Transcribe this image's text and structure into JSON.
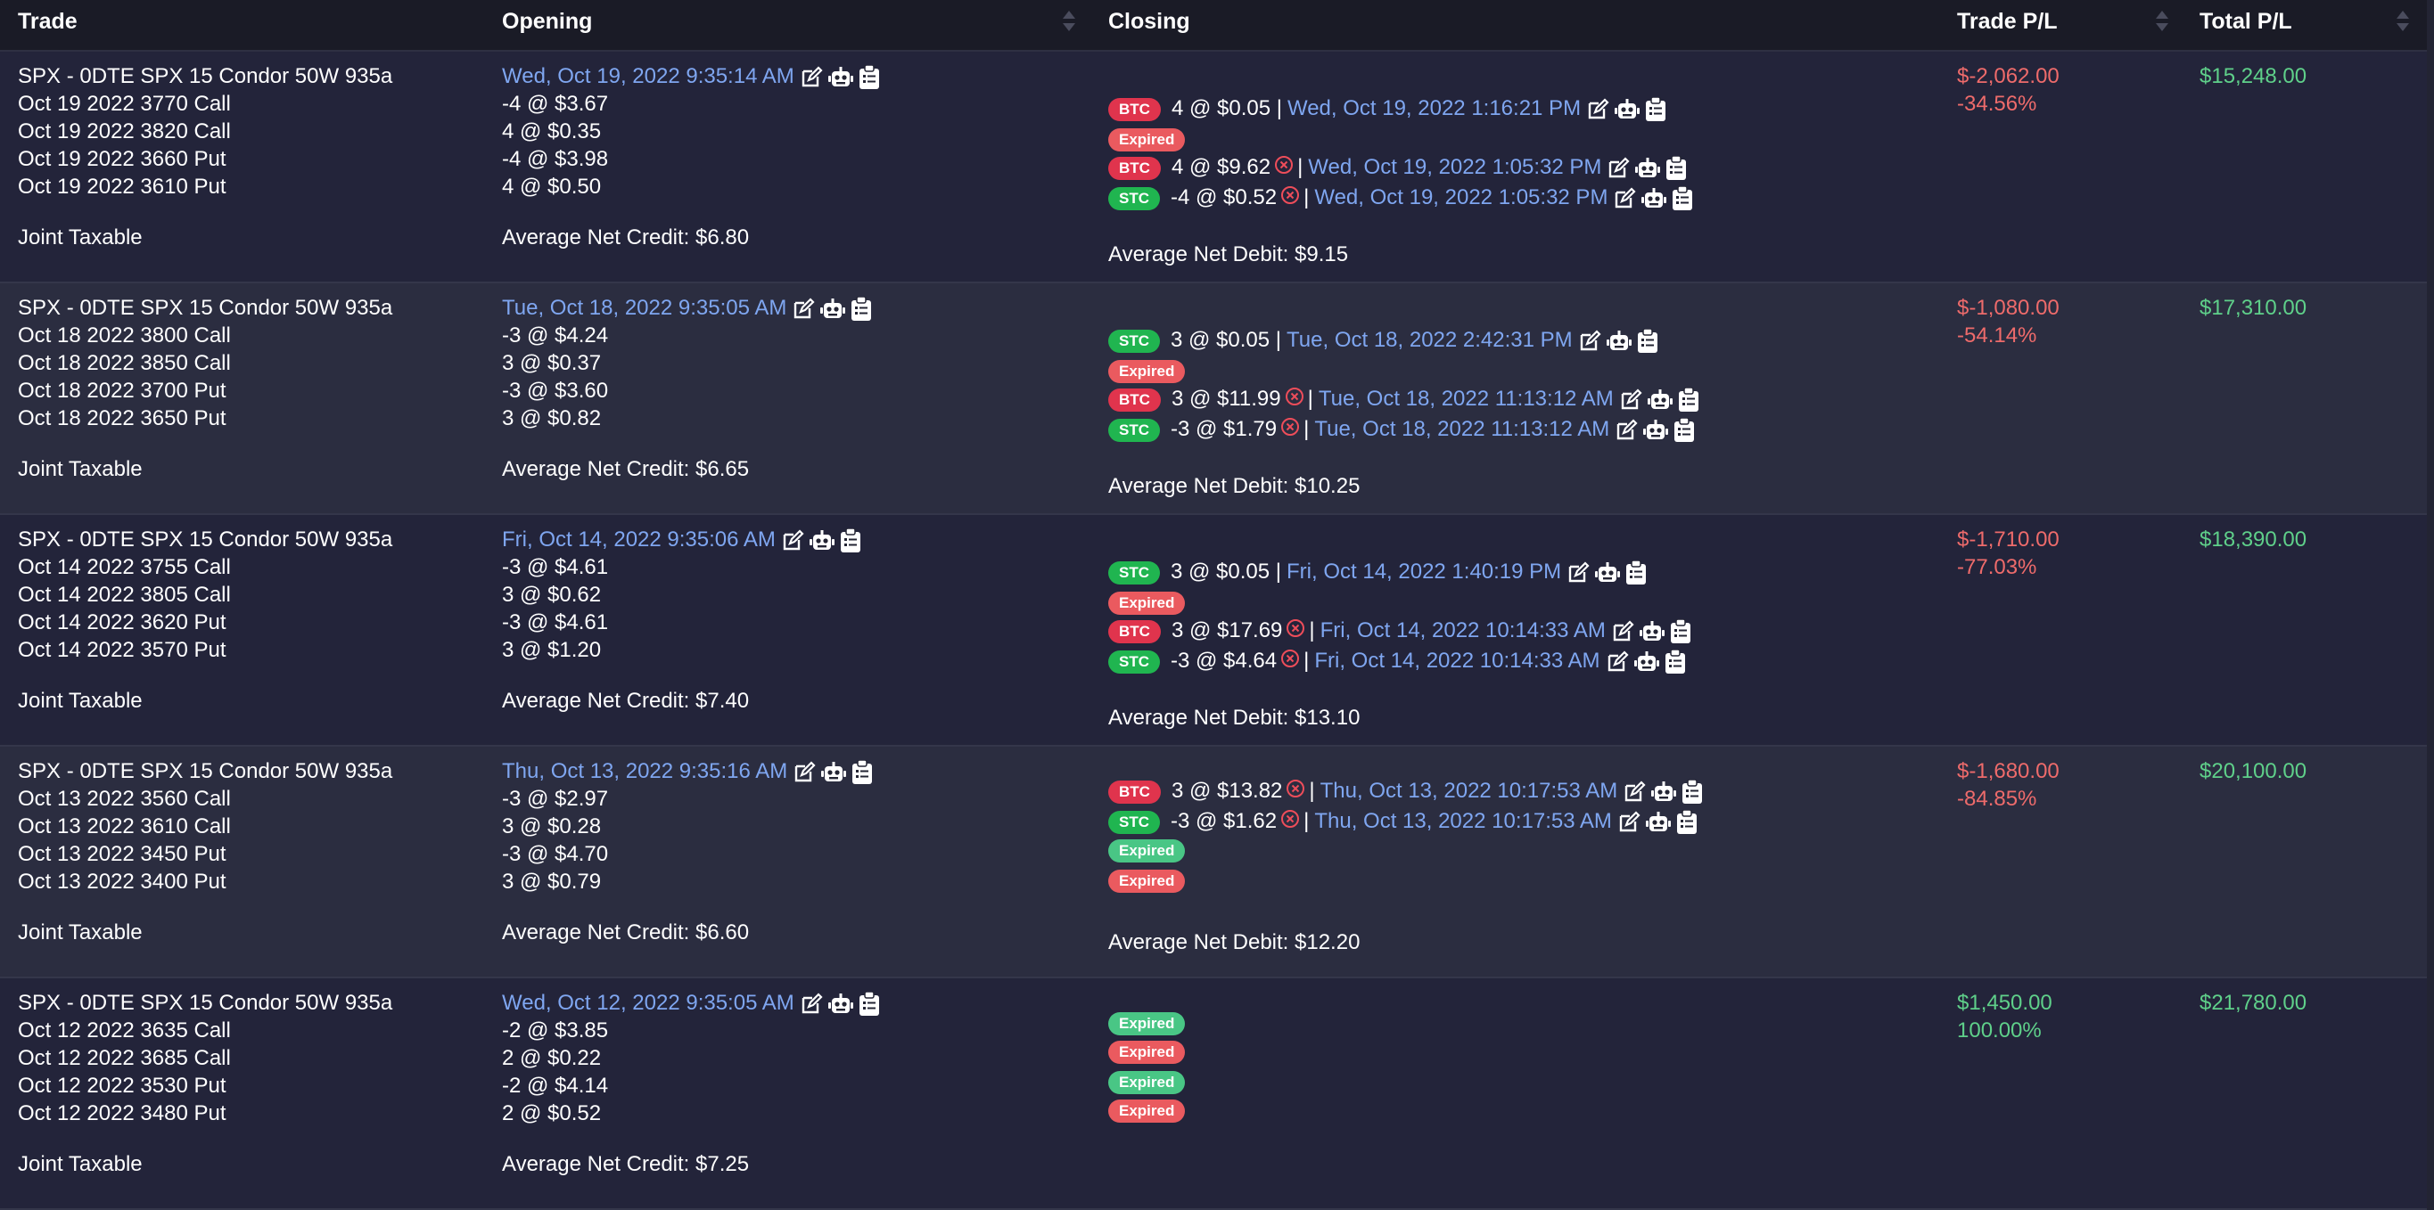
{
  "headers": {
    "trade": "Trade",
    "opening": "Opening",
    "closing": "Closing",
    "trade_pl": "Trade P/L",
    "total_pl": "Total P/L"
  },
  "trades": [
    {
      "title": "SPX - 0DTE SPX 15 Condor 50W 935a",
      "legs": [
        "Oct 19 2022 3770 Call",
        "Oct 19 2022 3820 Call",
        "Oct 19 2022 3660 Put",
        "Oct 19 2022 3610 Put"
      ],
      "account": "Joint Taxable",
      "open_date": "Wed, Oct 19, 2022 9:35:14 AM",
      "open_fills": [
        "-4 @ $3.67",
        "4 @ $0.35",
        "-4 @ $3.98",
        "4 @ $0.50"
      ],
      "avg_open": "Average Net Credit: $6.80",
      "closings": [
        {
          "badge": "BTC",
          "color": "btc",
          "fill": "4 @ $0.05",
          "x": false,
          "date": "Wed, Oct 19, 2022 1:16:21 PM"
        },
        {
          "badge": "Expired",
          "color": "exp-red"
        },
        {
          "badge": "BTC",
          "color": "btc",
          "fill": "4 @ $9.62",
          "x": true,
          "date": "Wed, Oct 19, 2022 1:05:32 PM"
        },
        {
          "badge": "STC",
          "color": "stc",
          "fill": "-4 @ $0.52",
          "x": true,
          "date": "Wed, Oct 19, 2022 1:05:32 PM"
        }
      ],
      "avg_close": "Average Net Debit: $9.15",
      "trade_pl": "$-2,062.00",
      "trade_pct": "-34.56%",
      "trade_pl_sign": "neg",
      "total_pl": "$15,248.00"
    },
    {
      "title": "SPX - 0DTE SPX 15 Condor 50W 935a",
      "legs": [
        "Oct 18 2022 3800 Call",
        "Oct 18 2022 3850 Call",
        "Oct 18 2022 3700 Put",
        "Oct 18 2022 3650 Put"
      ],
      "account": "Joint Taxable",
      "open_date": "Tue, Oct 18, 2022 9:35:05 AM",
      "open_fills": [
        "-3 @ $4.24",
        "3 @ $0.37",
        "-3 @ $3.60",
        "3 @ $0.82"
      ],
      "avg_open": "Average Net Credit: $6.65",
      "closings": [
        {
          "badge": "STC",
          "color": "stc",
          "fill": "3 @ $0.05",
          "x": false,
          "date": "Tue, Oct 18, 2022 2:42:31 PM"
        },
        {
          "badge": "Expired",
          "color": "exp-red"
        },
        {
          "badge": "BTC",
          "color": "btc",
          "fill": "3 @ $11.99",
          "x": true,
          "date": "Tue, Oct 18, 2022 11:13:12 AM"
        },
        {
          "badge": "STC",
          "color": "stc",
          "fill": "-3 @ $1.79",
          "x": true,
          "date": "Tue, Oct 18, 2022 11:13:12 AM"
        }
      ],
      "avg_close": "Average Net Debit: $10.25",
      "trade_pl": "$-1,080.00",
      "trade_pct": "-54.14%",
      "trade_pl_sign": "neg",
      "total_pl": "$17,310.00"
    },
    {
      "title": "SPX - 0DTE SPX 15 Condor 50W 935a",
      "legs": [
        "Oct 14 2022 3755 Call",
        "Oct 14 2022 3805 Call",
        "Oct 14 2022 3620 Put",
        "Oct 14 2022 3570 Put"
      ],
      "account": "Joint Taxable",
      "open_date": "Fri, Oct 14, 2022 9:35:06 AM",
      "open_fills": [
        "-3 @ $4.61",
        "3 @ $0.62",
        "-3 @ $4.61",
        "3 @ $1.20"
      ],
      "avg_open": "Average Net Credit: $7.40",
      "closings": [
        {
          "badge": "STC",
          "color": "stc",
          "fill": "3 @ $0.05",
          "x": false,
          "date": "Fri, Oct 14, 2022 1:40:19 PM"
        },
        {
          "badge": "Expired",
          "color": "exp-red"
        },
        {
          "badge": "BTC",
          "color": "btc",
          "fill": "3 @ $17.69",
          "x": true,
          "date": "Fri, Oct 14, 2022 10:14:33 AM"
        },
        {
          "badge": "STC",
          "color": "stc",
          "fill": "-3 @ $4.64",
          "x": true,
          "date": "Fri, Oct 14, 2022 10:14:33 AM"
        }
      ],
      "avg_close": "Average Net Debit: $13.10",
      "trade_pl": "$-1,710.00",
      "trade_pct": "-77.03%",
      "trade_pl_sign": "neg",
      "total_pl": "$18,390.00"
    },
    {
      "title": "SPX - 0DTE SPX 15 Condor 50W 935a",
      "legs": [
        "Oct 13 2022 3560 Call",
        "Oct 13 2022 3610 Call",
        "Oct 13 2022 3450 Put",
        "Oct 13 2022 3400 Put"
      ],
      "account": "Joint Taxable",
      "open_date": "Thu, Oct 13, 2022 9:35:16 AM",
      "open_fills": [
        "-3 @ $2.97",
        "3 @ $0.28",
        "-3 @ $4.70",
        "3 @ $0.79"
      ],
      "avg_open": "Average Net Credit: $6.60",
      "closings": [
        {
          "badge": "BTC",
          "color": "btc",
          "fill": "3 @ $13.82",
          "x": true,
          "date": "Thu, Oct 13, 2022 10:17:53 AM"
        },
        {
          "badge": "STC",
          "color": "stc",
          "fill": "-3 @ $1.62",
          "x": true,
          "date": "Thu, Oct 13, 2022 10:17:53 AM"
        },
        {
          "badge": "Expired",
          "color": "exp-green"
        },
        {
          "badge": "Expired",
          "color": "exp-red"
        }
      ],
      "avg_close": "Average Net Debit: $12.20",
      "trade_pl": "$-1,680.00",
      "trade_pct": "-84.85%",
      "trade_pl_sign": "neg",
      "total_pl": "$20,100.00"
    },
    {
      "title": "SPX - 0DTE SPX 15 Condor 50W 935a",
      "legs": [
        "Oct 12 2022 3635 Call",
        "Oct 12 2022 3685 Call",
        "Oct 12 2022 3530 Put",
        "Oct 12 2022 3480 Put"
      ],
      "account": "Joint Taxable",
      "open_date": "Wed, Oct 12, 2022 9:35:05 AM",
      "open_fills": [
        "-2 @ $3.85",
        "2 @ $0.22",
        "-2 @ $4.14",
        "2 @ $0.52"
      ],
      "avg_open": "Average Net Credit: $7.25",
      "closings": [
        {
          "badge": "Expired",
          "color": "exp-green"
        },
        {
          "badge": "Expired",
          "color": "exp-red"
        },
        {
          "badge": "Expired",
          "color": "exp-green"
        },
        {
          "badge": "Expired",
          "color": "exp-red"
        }
      ],
      "avg_close": "",
      "trade_pl": "$1,450.00",
      "trade_pct": "100.00%",
      "trade_pl_sign": "pos",
      "total_pl": "$21,780.00"
    }
  ],
  "colors": {
    "link": "#7fa6f0",
    "negative": "#ee6b6b",
    "positive": "#5fd08a",
    "btc": "#e0344d",
    "stc": "#20b550"
  }
}
